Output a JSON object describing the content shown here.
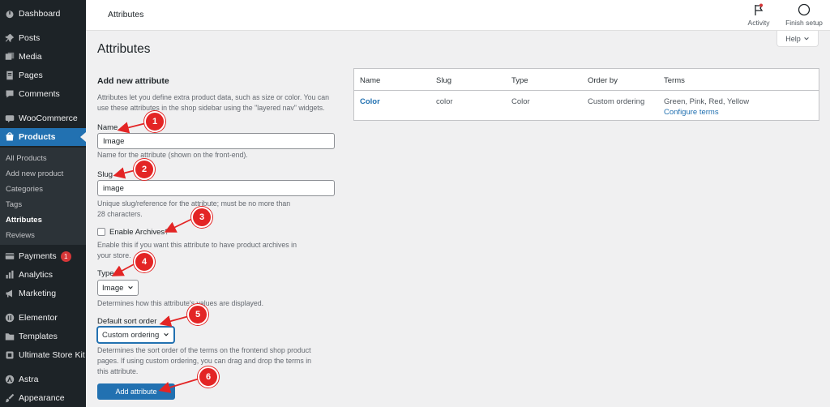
{
  "sidebar": {
    "items": [
      {
        "label": "Dashboard",
        "icon": "dashboard-icon"
      },
      {
        "label": "Posts",
        "icon": "pin-icon"
      },
      {
        "label": "Media",
        "icon": "media-icon"
      },
      {
        "label": "Pages",
        "icon": "pages-icon"
      },
      {
        "label": "Comments",
        "icon": "comment-icon"
      },
      {
        "label": "WooCommerce",
        "icon": "woocommerce-icon"
      },
      {
        "label": "Products",
        "icon": "products-icon"
      },
      {
        "label": "Payments",
        "icon": "payments-icon",
        "badge": "1"
      },
      {
        "label": "Analytics",
        "icon": "analytics-icon"
      },
      {
        "label": "Marketing",
        "icon": "megaphone-icon"
      },
      {
        "label": "Elementor",
        "icon": "elementor-icon"
      },
      {
        "label": "Templates",
        "icon": "folder-icon"
      },
      {
        "label": "Ultimate Store Kit",
        "icon": "store-kit-icon"
      },
      {
        "label": "Astra",
        "icon": "astra-icon"
      },
      {
        "label": "Appearance",
        "icon": "brush-icon"
      }
    ],
    "submenu": [
      "All Products",
      "Add new product",
      "Categories",
      "Tags",
      "Attributes",
      "Reviews"
    ]
  },
  "topbar": {
    "title": "Attributes",
    "activity_label": "Activity",
    "finish_setup_label": "Finish setup"
  },
  "help_label": "Help",
  "page_title": "Attributes",
  "form": {
    "heading": "Add new attribute",
    "intro": "Attributes let you define extra product data, such as size or color. You can use these attributes in the shop sidebar using the \"layered nav\" widgets.",
    "name_label": "Name",
    "name_value": "Image",
    "name_desc": "Name for the attribute (shown on the front-end).",
    "slug_label": "Slug",
    "slug_value": "image",
    "slug_desc_1": "Unique slug/reference for the attribute; must be no more than",
    "slug_desc_2": "28 characters.",
    "archives_label": "Enable Archives?",
    "archives_desc_1": "Enable this if you want this attribute to have product archives in",
    "archives_desc_2": "your store.",
    "type_label": "Type",
    "type_value": "Image",
    "type_desc": "Determines how this attribute's values are displayed.",
    "sort_label": "Default sort order",
    "sort_value": "Custom ordering",
    "sort_desc_1": "Determines the sort order of the terms on the frontend shop product",
    "sort_desc_2": "pages. If using custom ordering, you can drag and drop the terms in",
    "sort_desc_3": "this attribute.",
    "submit_label": "Add attribute"
  },
  "table": {
    "headers": [
      "Name",
      "Slug",
      "Type",
      "Order by",
      "Terms"
    ],
    "rows": [
      {
        "name": "Color",
        "slug": "color",
        "type": "Color",
        "order_by": "Custom ordering",
        "terms": "Green, Pink, Red, Yellow",
        "configure": "Configure terms"
      }
    ]
  },
  "annotations": [
    "1",
    "2",
    "3",
    "4",
    "5",
    "6"
  ],
  "colors": {
    "admin_bar": "#1d2327",
    "accent": "#2271b1",
    "annotation": "#e32525"
  }
}
